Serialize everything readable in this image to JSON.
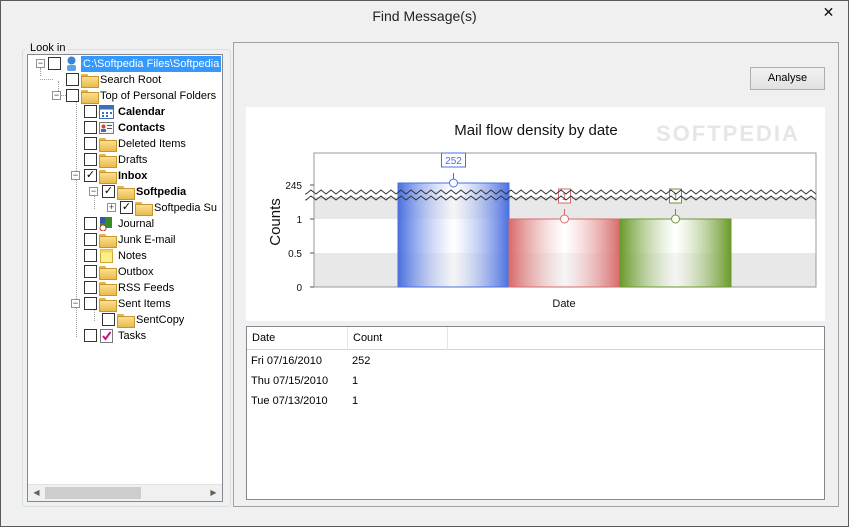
{
  "window": {
    "title": "Find Message(s)",
    "close_glyph": "✕"
  },
  "tree": {
    "group_label": "Look in",
    "nodes": [
      {
        "label": "C:\\Softpedia Files\\Softpedia",
        "selected": true
      },
      {
        "label": "Search Root"
      },
      {
        "label": "Top of Personal Folders"
      },
      {
        "label": "Calendar",
        "bold": true
      },
      {
        "label": "Contacts",
        "bold": true
      },
      {
        "label": "Deleted Items"
      },
      {
        "label": "Drafts"
      },
      {
        "label": "Inbox",
        "bold": true
      },
      {
        "label": "Softpedia",
        "bold": true
      },
      {
        "label": "Softpedia Su"
      },
      {
        "label": "Journal"
      },
      {
        "label": "Junk E-mail"
      },
      {
        "label": "Notes"
      },
      {
        "label": "Outbox"
      },
      {
        "label": "RSS Feeds"
      },
      {
        "label": "Sent Items"
      },
      {
        "label": "SentCopy"
      },
      {
        "label": "Tasks"
      }
    ]
  },
  "toolbar": {
    "analyse_label": "Analyse"
  },
  "chart": {
    "title": "Mail flow density by date",
    "ylabel": "Counts",
    "xlabel": "Date",
    "watermark": "SOFTPEDIA",
    "colors": {
      "bar1": "#4a70e0",
      "bar2": "#d86a6a",
      "bar3": "#6a9a2a"
    }
  },
  "chart_data": {
    "type": "bar",
    "title": "Mail flow density by date",
    "xlabel": "Date",
    "ylabel": "Counts",
    "categories": [
      "Fri 07/16/2010",
      "Thu 07/15/2010",
      "Tue 07/13/2010"
    ],
    "values": [
      252,
      1,
      1
    ],
    "y_ticks": [
      "0",
      "0.5",
      "1",
      "245"
    ],
    "axis_break": true,
    "grid": true
  },
  "grid": {
    "columns": [
      "Date",
      "Count"
    ],
    "rows": [
      [
        "Fri 07/16/2010",
        "252"
      ],
      [
        "Thu 07/15/2010",
        "1"
      ],
      [
        "Tue 07/13/2010",
        "1"
      ]
    ]
  }
}
